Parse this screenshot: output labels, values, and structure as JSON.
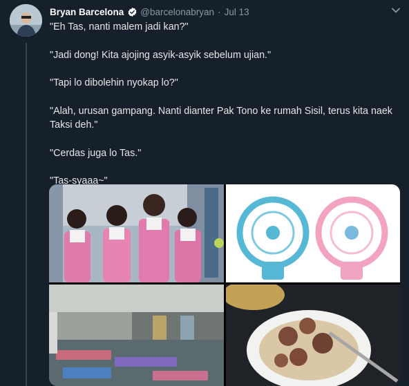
{
  "tweet": {
    "author_name": "Bryan Barcelona",
    "handle": "@barcelonabryan",
    "separator": "·",
    "date": "Jul 13",
    "lines": [
      "\"Eh Tas, nanti malem jadi kan?\"",
      "\"Jadi dong! Kita ajojing asyik-asyik sebelum ujian.\"",
      "\"Tapi lo dibolehin nyokap lo?\"",
      "\"Alah, urusan gampang. Nanti dianter Pak Tono ke rumah Sisil, terus kita naek Taksi deh.\"",
      "\"Cerdas juga lo Tas.\"",
      "\"Tas-syaaa~\""
    ]
  },
  "icons": {
    "verified": "verified-badge-icon",
    "more": "chevron-down-icon"
  },
  "colors": {
    "background": "#15202b",
    "text": "#e6e6e6",
    "muted": "#8b98a5",
    "verified": "#ffffff"
  },
  "media": {
    "photos": [
      "schoolgirls-photo",
      "fans-photo",
      "canteen-photo",
      "bakso-photo"
    ]
  }
}
